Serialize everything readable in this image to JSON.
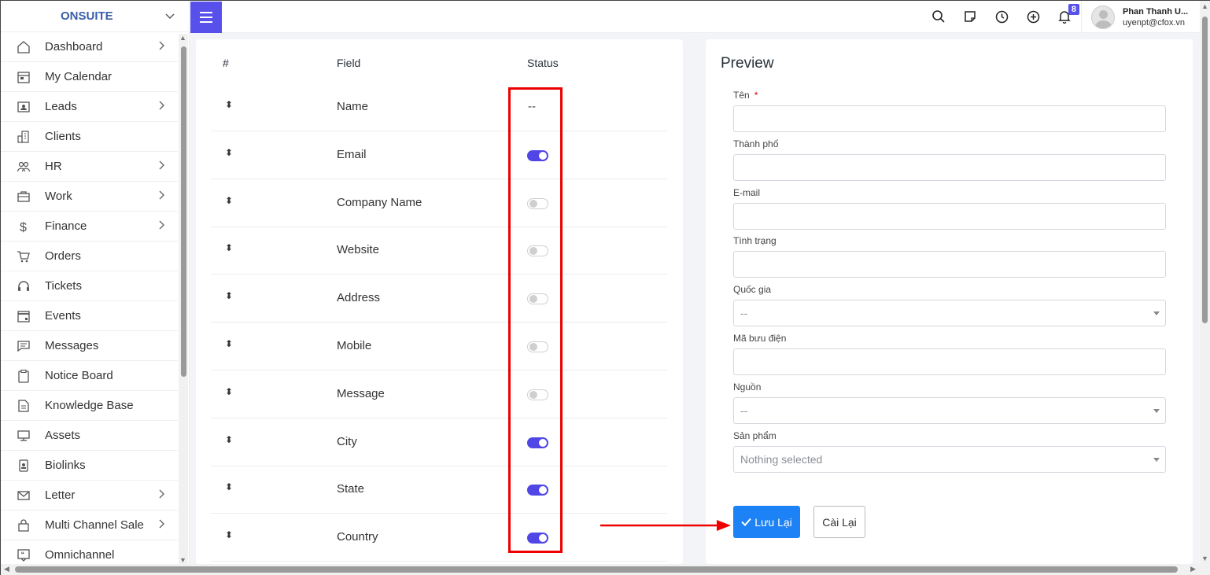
{
  "brand": {
    "name": "ONSUITE"
  },
  "sidebar": {
    "items": [
      {
        "label": "Dashboard",
        "icon": "home-icon",
        "arrow": true
      },
      {
        "label": "My Calendar",
        "icon": "calendar-icon",
        "arrow": false
      },
      {
        "label": "Leads",
        "icon": "contact-card-icon",
        "arrow": true
      },
      {
        "label": "Clients",
        "icon": "building-icon",
        "arrow": false
      },
      {
        "label": "HR",
        "icon": "people-icon",
        "arrow": true
      },
      {
        "label": "Work",
        "icon": "briefcase-icon",
        "arrow": true
      },
      {
        "label": "Finance",
        "icon": "dollar-icon",
        "arrow": true
      },
      {
        "label": "Orders",
        "icon": "cart-icon",
        "arrow": false
      },
      {
        "label": "Tickets",
        "icon": "headset-icon",
        "arrow": false
      },
      {
        "label": "Events",
        "icon": "calendar-event-icon",
        "arrow": false
      },
      {
        "label": "Messages",
        "icon": "message-icon",
        "arrow": false
      },
      {
        "label": "Notice Board",
        "icon": "clipboard-icon",
        "arrow": false
      },
      {
        "label": "Knowledge Base",
        "icon": "document-icon",
        "arrow": false
      },
      {
        "label": "Assets",
        "icon": "monitor-icon",
        "arrow": false
      },
      {
        "label": "Biolinks",
        "icon": "badge-icon",
        "arrow": false
      },
      {
        "label": "Letter",
        "icon": "envelope-icon",
        "arrow": true
      },
      {
        "label": "Multi Channel Sale",
        "icon": "bag-icon",
        "arrow": true
      },
      {
        "label": "Omnichannel",
        "icon": "chat-icon",
        "arrow": false
      }
    ]
  },
  "topbar": {
    "notification_count": "8",
    "user_name": "Phan Thanh U...",
    "user_email": "uyenpt@cfox.vn"
  },
  "fields_table": {
    "headers": {
      "index": "#",
      "field": "Field",
      "status": "Status"
    },
    "rows": [
      {
        "name": "Name",
        "status": "fixed",
        "status_text": "--"
      },
      {
        "name": "Email",
        "status": "on"
      },
      {
        "name": "Company Name",
        "status": "off"
      },
      {
        "name": "Website",
        "status": "off"
      },
      {
        "name": "Address",
        "status": "off"
      },
      {
        "name": "Mobile",
        "status": "off"
      },
      {
        "name": "Message",
        "status": "off"
      },
      {
        "name": "City",
        "status": "on"
      },
      {
        "name": "State",
        "status": "on"
      },
      {
        "name": "Country",
        "status": "on"
      }
    ]
  },
  "preview": {
    "title": "Preview",
    "fields": [
      {
        "label": "Tên",
        "required": true,
        "type": "input",
        "value": ""
      },
      {
        "label": "Thành phố",
        "required": false,
        "type": "input",
        "value": ""
      },
      {
        "label": "E-mail",
        "required": false,
        "type": "input",
        "value": ""
      },
      {
        "label": "Tình trạng",
        "required": false,
        "type": "input",
        "value": ""
      },
      {
        "label": "Quốc gia",
        "required": false,
        "type": "select",
        "value": "--"
      },
      {
        "label": "Mã bưu điện",
        "required": false,
        "type": "input",
        "value": ""
      },
      {
        "label": "Nguồn",
        "required": false,
        "type": "select",
        "value": "--"
      },
      {
        "label": "Sản phẩm",
        "required": false,
        "type": "select",
        "value": "Nothing selected"
      }
    ],
    "save_label": "Lưu Lại",
    "reset_label": "Cài Lại"
  },
  "colors": {
    "accent": "#5750ea",
    "toggle_on": "#4f46e5",
    "save_button": "#1d82f5",
    "highlight": "#ee0000"
  }
}
